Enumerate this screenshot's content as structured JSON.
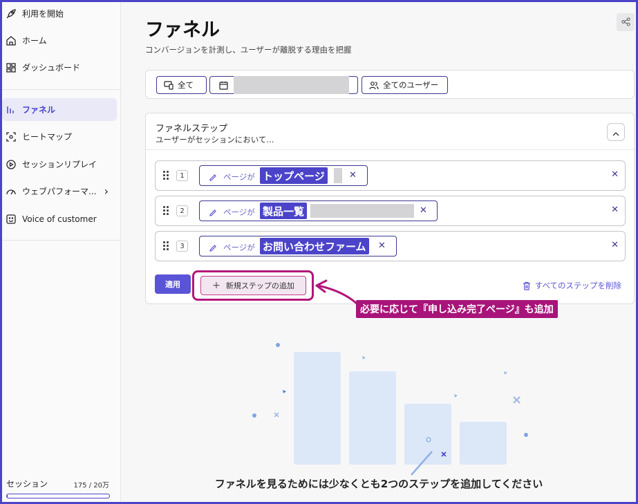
{
  "sidebar": {
    "items": [
      {
        "label": "利用を開始",
        "icon": "rocket-icon"
      },
      {
        "label": "ホーム",
        "icon": "home-icon"
      },
      {
        "label": "ダッシュボード",
        "icon": "dashboard-icon"
      },
      {
        "label": "ファネル",
        "icon": "funnel-icon",
        "active": true
      },
      {
        "label": "ヒートマップ",
        "icon": "heatmap-icon"
      },
      {
        "label": "セッションリプレイ",
        "icon": "play-icon"
      },
      {
        "label": "ウェブパフォーマ...",
        "icon": "gauge-icon"
      },
      {
        "label": "Voice of customer",
        "icon": "smile-icon"
      }
    ],
    "session": {
      "label": "セッション",
      "count": "175 / 20万",
      "progress": 0.01
    }
  },
  "header": {
    "title": "ファネル",
    "subtitle": "コンバージョンを計測し、ユーザーが離脱する理由を把握"
  },
  "filters": {
    "device": "全て",
    "users": "全てのユーザー"
  },
  "funnel": {
    "title": "ファネルステップ",
    "subtitle": "ユーザーがセッションにおいて...",
    "cond_prefix": "ページが",
    "steps": [
      {
        "num": "1",
        "value": "トップページ"
      },
      {
        "num": "2",
        "value": "製品一覧"
      },
      {
        "num": "3",
        "value": "お問い合わせファーム"
      }
    ],
    "apply_label": "適用",
    "add_label": "新規ステップの追加",
    "delete_all_label": "すべてのステップを削除"
  },
  "annotation": "必要に応じて『申し込み完了ページ』も追加",
  "empty_message": "ファネルを見るためには少なくとも2つのステップを追加してください",
  "colors": {
    "accent": "#4b44c9",
    "annotation": "#a8147a",
    "illustration": "#dce8f8"
  }
}
